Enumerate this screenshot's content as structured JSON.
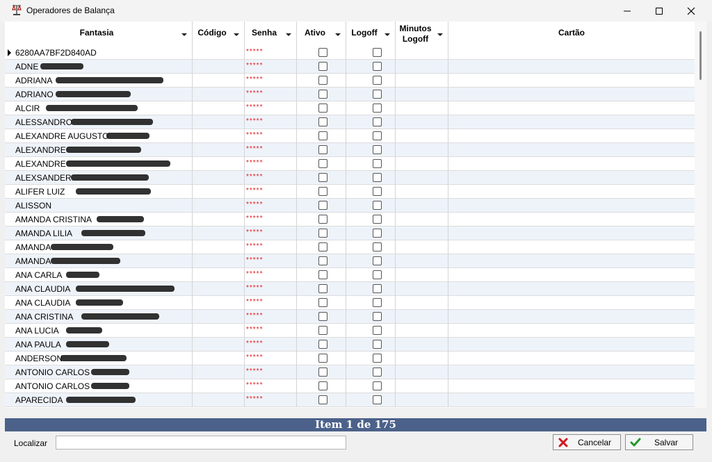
{
  "window": {
    "title": "Operadores de Balança"
  },
  "columns": [
    {
      "key": "fantasia",
      "label": "Fantasia"
    },
    {
      "key": "codigo",
      "label": "Código"
    },
    {
      "key": "senha",
      "label": "Senha"
    },
    {
      "key": "ativo",
      "label": "Ativo"
    },
    {
      "key": "logoff",
      "label": "Logoff"
    },
    {
      "key": "minutos_logoff",
      "label": "Minutos\nLogoff"
    },
    {
      "key": "cartao",
      "label": "Cartão"
    }
  ],
  "rows": [
    {
      "fantasia": "6280AA7BF2D840AD",
      "redacted": false,
      "senha": "*****"
    },
    {
      "fantasia": "ADNE",
      "redacted": true,
      "senha": "*****"
    },
    {
      "fantasia": "ADRIANA",
      "redacted": true,
      "senha": "*****"
    },
    {
      "fantasia": "ADRIANO",
      "redacted": true,
      "senha": "*****"
    },
    {
      "fantasia": "ALCIR",
      "redacted": true,
      "senha": "*****"
    },
    {
      "fantasia": "ALESSANDRO",
      "redacted": true,
      "senha": "*****"
    },
    {
      "fantasia": "ALEXANDRE AUGUSTO",
      "redacted": true,
      "senha": "*****"
    },
    {
      "fantasia": "ALEXANDRE",
      "redacted": true,
      "senha": "*****"
    },
    {
      "fantasia": "ALEXANDRE",
      "redacted": true,
      "senha": "*****"
    },
    {
      "fantasia": "ALEXSANDER",
      "redacted": true,
      "senha": "*****"
    },
    {
      "fantasia": "ALIFER LUIZ",
      "redacted": true,
      "senha": "*****"
    },
    {
      "fantasia": "ALISSON",
      "redacted": false,
      "senha": "*****"
    },
    {
      "fantasia": "AMANDA CRISTINA",
      "redacted": true,
      "senha": "*****"
    },
    {
      "fantasia": "AMANDA LILIA",
      "redacted": true,
      "senha": "*****"
    },
    {
      "fantasia": "AMANDA",
      "redacted": true,
      "senha": "*****"
    },
    {
      "fantasia": "AMANDA",
      "redacted": true,
      "senha": "*****"
    },
    {
      "fantasia": "ANA CARLA",
      "redacted": true,
      "senha": "*****"
    },
    {
      "fantasia": "ANA CLAUDIA",
      "redacted": true,
      "senha": "*****"
    },
    {
      "fantasia": "ANA CLAUDIA",
      "redacted": true,
      "senha": "*****"
    },
    {
      "fantasia": "ANA CRISTINA",
      "redacted": true,
      "senha": "*****"
    },
    {
      "fantasia": "ANA LUCIA",
      "redacted": true,
      "senha": "*****"
    },
    {
      "fantasia": "ANA PAULA",
      "redacted": true,
      "senha": "*****"
    },
    {
      "fantasia": "ANDERSON",
      "redacted": true,
      "senha": "*****"
    },
    {
      "fantasia": "ANTONIO CARLOS",
      "redacted": true,
      "senha": "*****"
    },
    {
      "fantasia": "ANTONIO CARLOS",
      "redacted": true,
      "senha": "*****"
    },
    {
      "fantasia": "APARECIDA",
      "redacted": true,
      "senha": "*****"
    }
  ],
  "status": {
    "text": "Item 1 de 175"
  },
  "search": {
    "label": "Localizar",
    "value": ""
  },
  "buttons": {
    "cancel_label": "Cancelar",
    "save_label": "Salvar"
  },
  "colors": {
    "status_bar": "#4b6189",
    "password_mask": "#e0191e",
    "cancel_icon": "#d0181e",
    "save_icon": "#1f9a2e",
    "alt_row": "#eef3fa"
  },
  "icons": {
    "app": "scale-app-icon",
    "minimize": "minimize-icon",
    "maximize": "maximize-icon",
    "close": "close-icon",
    "cancel": "x-icon",
    "save": "check-icon"
  }
}
